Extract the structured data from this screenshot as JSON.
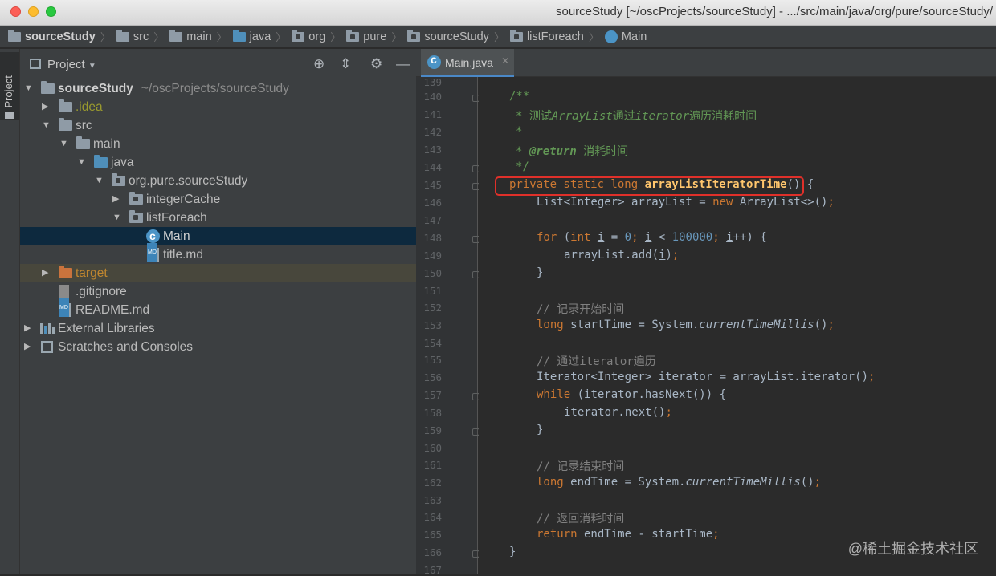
{
  "window": {
    "title": "sourceStudy [~/oscProjects/sourceStudy] - .../src/main/java/org/pure/sourceStudy/"
  },
  "breadcrumbs": [
    "sourceStudy",
    "src",
    "main",
    "java",
    "org",
    "pure",
    "sourceStudy",
    "listForeach",
    "Main"
  ],
  "sidebar_tab": "1: Project",
  "project_panel": {
    "title": "Project",
    "tree": [
      {
        "label": "sourceStudy",
        "suffix": "~/oscProjects/sourceStudy"
      },
      {
        "label": ".idea"
      },
      {
        "label": "src"
      },
      {
        "label": "main"
      },
      {
        "label": "java"
      },
      {
        "label": "org.pure.sourceStudy"
      },
      {
        "label": "integerCache"
      },
      {
        "label": "listForeach"
      },
      {
        "label": "Main"
      },
      {
        "label": "title.md"
      },
      {
        "label": "target"
      },
      {
        "label": ".gitignore"
      },
      {
        "label": "README.md"
      },
      {
        "label": "External Libraries"
      },
      {
        "label": "Scratches and Consoles"
      }
    ]
  },
  "editor": {
    "tab_label": "Main.java",
    "line_numbers": [
      "139",
      "140",
      "141",
      "142",
      "143",
      "144",
      "145",
      "146",
      "147",
      "148",
      "149",
      "150",
      "151",
      "152",
      "153",
      "154",
      "155",
      "156",
      "157",
      "158",
      "159",
      "160",
      "161",
      "162",
      "163",
      "164",
      "165",
      "166",
      "167"
    ]
  },
  "code": {
    "l140": "/**",
    "l141a": "* 测试",
    "l141b": "ArrayList",
    "l141c": "通过",
    "l141d": "iterator",
    "l141e": "遍历消耗时间",
    "l142": "*",
    "l143a": "* ",
    "l143b": "@return",
    "l143c": " 消耗时间",
    "l144": "*/",
    "l145a": "private static long ",
    "l145b": "arrayListIteratorTime",
    "l145c": "() {",
    "l146a": "List<Integer> arrayList = ",
    "l146b": "new",
    "l146c": " ArrayList<>()",
    "l146d": ";",
    "l148a": "for",
    "l148b": " (",
    "l148c": "int",
    "l148d": " ",
    "l148e": "i",
    "l148f": " = ",
    "l148g": "0",
    "l148h": "; ",
    "l148i": "i",
    "l148j": " < ",
    "l148k": "100000",
    "l148l": "; ",
    "l148m": "i",
    "l148n": "++) {",
    "l149a": "arrayList.add(",
    "l149b": "i",
    "l149c": ")",
    "l149d": ";",
    "l150": "}",
    "l152": "// 记录开始时间",
    "l153a": "long",
    "l153b": " startTime = System.",
    "l153c": "currentTimeMillis",
    "l153d": "()",
    "l153e": ";",
    "l155": "// 通过iterator遍历",
    "l156a": "Iterator<Integer> iterator = arrayList.iterator()",
    "l156b": ";",
    "l157a": "while",
    "l157b": " (iterator.hasNext()) {",
    "l158a": "iterator.next()",
    "l158b": ";",
    "l159": "}",
    "l161": "// 记录结束时间",
    "l162a": "long",
    "l162b": " endTime = System.",
    "l162c": "currentTimeMillis",
    "l162d": "()",
    "l162e": ";",
    "l164": "// 返回消耗时间",
    "l165a": "return",
    "l165b": " endTime - startTime",
    "l165c": ";",
    "l166": "}"
  },
  "watermark": "@稀土掘金技术社区",
  "colors": {
    "keyword": "#cc7832",
    "number": "#6897bb",
    "doc": "#629755",
    "comment": "#808080",
    "method": "#ffc66d",
    "highlight_box": "#e0302a",
    "selection": "#0d293e"
  }
}
